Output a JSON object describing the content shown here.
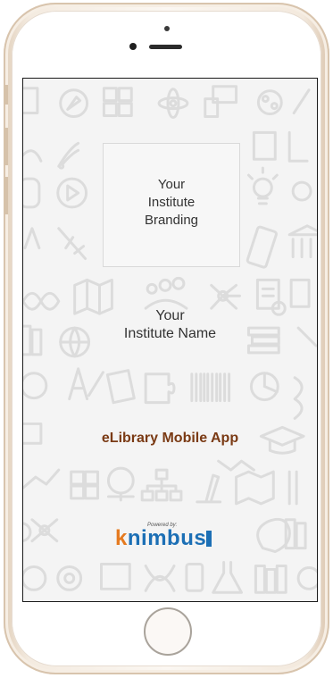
{
  "device": {
    "frame_color": "#f4ebe0",
    "accent_gold": "#d6c2aa"
  },
  "screen": {
    "branding_placeholder": "Your\nInstitute\nBranding",
    "institute_name": "Your\nInstitute Name",
    "app_title": "eLibrary Mobile App",
    "app_title_color": "#7a3a14",
    "powered_by": "Powered by:",
    "brand_k": "k",
    "brand_rest": "nimbus",
    "brand_blue": "#1c6fb5",
    "brand_orange": "#e57a1f"
  },
  "icons": [
    "book-icon",
    "compass-icon",
    "calculator-icon",
    "atom-icon",
    "devices-icon",
    "microscope-icon",
    "play-icon",
    "lightbulb-icon",
    "usb-icon",
    "phone-icon",
    "bank-icon",
    "infinity-icon",
    "map-icon",
    "people-icon",
    "network-icon",
    "globe-icon",
    "books-icon",
    "puzzle-icon",
    "barcode-icon",
    "pie-chart-icon",
    "graduation-cap-icon",
    "handshake-icon",
    "chart-icon",
    "flask-icon",
    "mouse-icon",
    "dna-icon"
  ]
}
